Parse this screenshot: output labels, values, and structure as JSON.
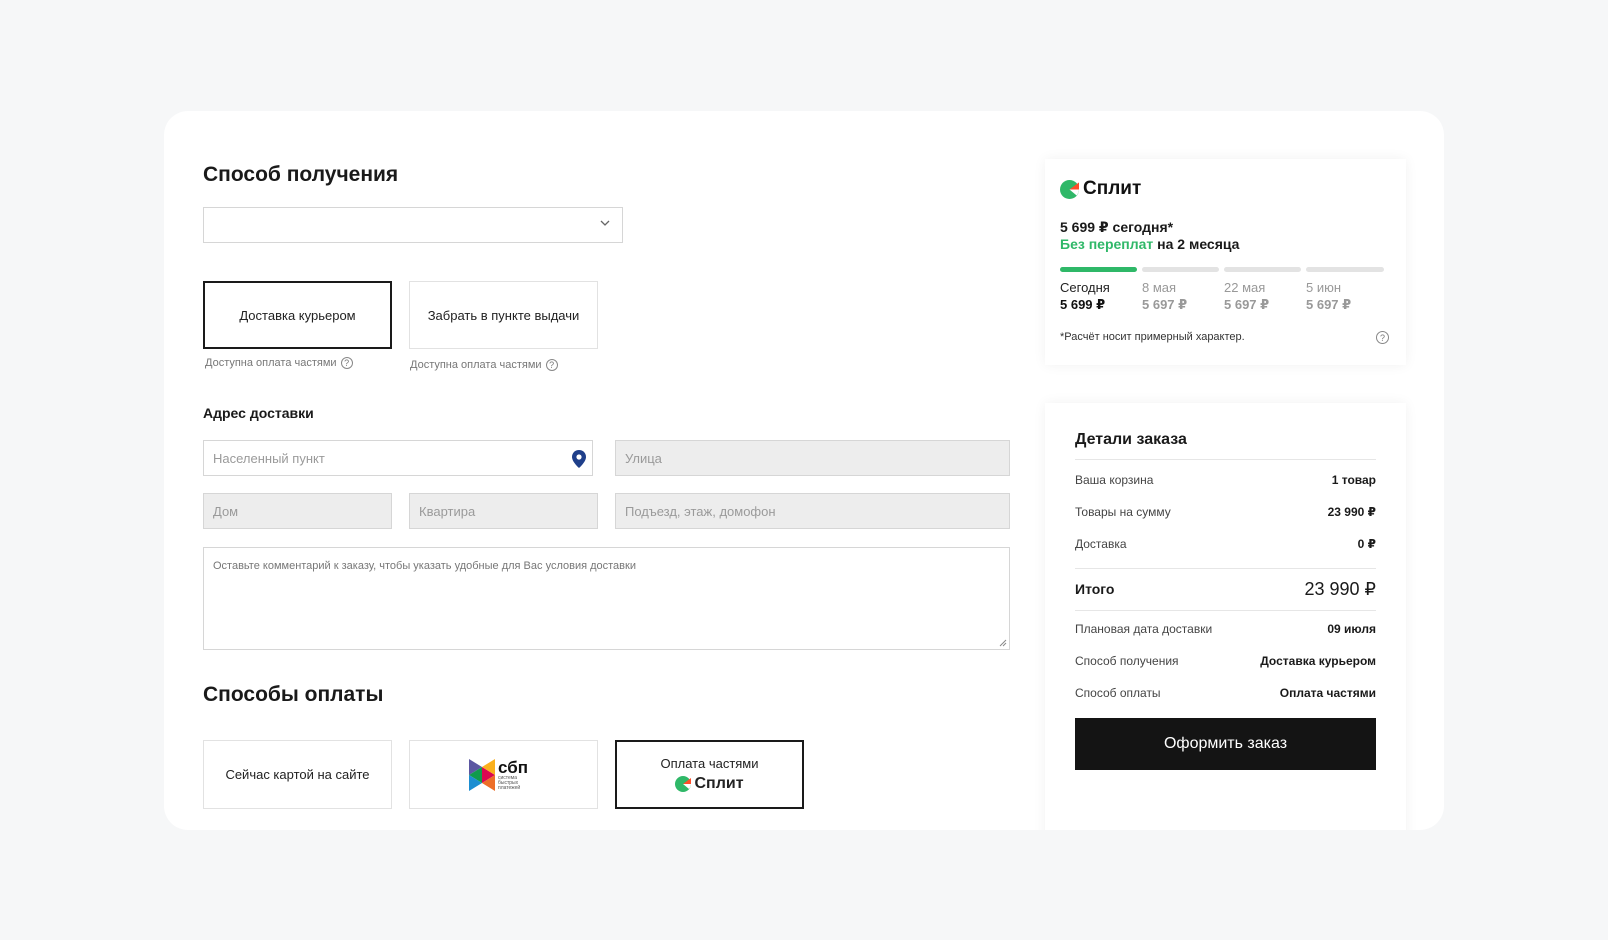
{
  "receipt": {
    "heading": "Способ получения",
    "select_value": "",
    "options": [
      {
        "label": "Доставка курьером",
        "hint": "Доступна оплата частями",
        "active": true
      },
      {
        "label": "Забрать в пункте выдачи",
        "hint": "Доступна оплата частями",
        "active": false
      }
    ]
  },
  "address": {
    "heading": "Адрес доставки",
    "city_placeholder": "Населенный пункт",
    "street_placeholder": "Улица",
    "house_placeholder": "Дом",
    "apartment_placeholder": "Квартира",
    "entrance_placeholder": "Подъезд, этаж, домофон",
    "comment_placeholder": "Оставьте комментарий к заказу, чтобы указать удобные для Вас условия доставки"
  },
  "payment": {
    "heading": "Способы оплаты",
    "card_label": "Сейчас картой на сайте",
    "sbp_label": "сбп",
    "sbp_sub": "система быстрых платежей",
    "split_label": "Оплата частями",
    "split_brand": "Сплит"
  },
  "split_widget": {
    "brand": "Сплит",
    "today_line": "5 699 ₽ сегодня*",
    "no_overpay": "Без переплат",
    "term": " на 2 месяца",
    "schedule": [
      {
        "date": "Сегодня",
        "amount": "5 699 ₽"
      },
      {
        "date": "8 мая",
        "amount": "5 697 ₽"
      },
      {
        "date": "22 мая",
        "amount": "5 697 ₽"
      },
      {
        "date": "5 июн",
        "amount": "5 697 ₽"
      }
    ],
    "disclaimer": "*Расчёт носит примерный характер."
  },
  "order_details": {
    "title": "Детали заказа",
    "rows": [
      {
        "label": "Ваша корзина",
        "value": "1 товар"
      },
      {
        "label": "Товары на сумму",
        "value": "23 990 ₽"
      },
      {
        "label": "Доставка",
        "value": "0 ₽"
      }
    ],
    "total_label": "Итого",
    "total_value": "23 990  ₽",
    "info_rows": [
      {
        "label": "Плановая дата доставки",
        "value": "09 июля"
      },
      {
        "label": "Способ получения",
        "value": "Доставка курьером"
      },
      {
        "label": "Способ оплаты",
        "value": "Оплата частями"
      }
    ],
    "submit_label": "Оформить заказ"
  },
  "colors": {
    "accent_green": "#2fb868",
    "button_dark": "#141414",
    "pin_blue": "#1f3f8a"
  }
}
